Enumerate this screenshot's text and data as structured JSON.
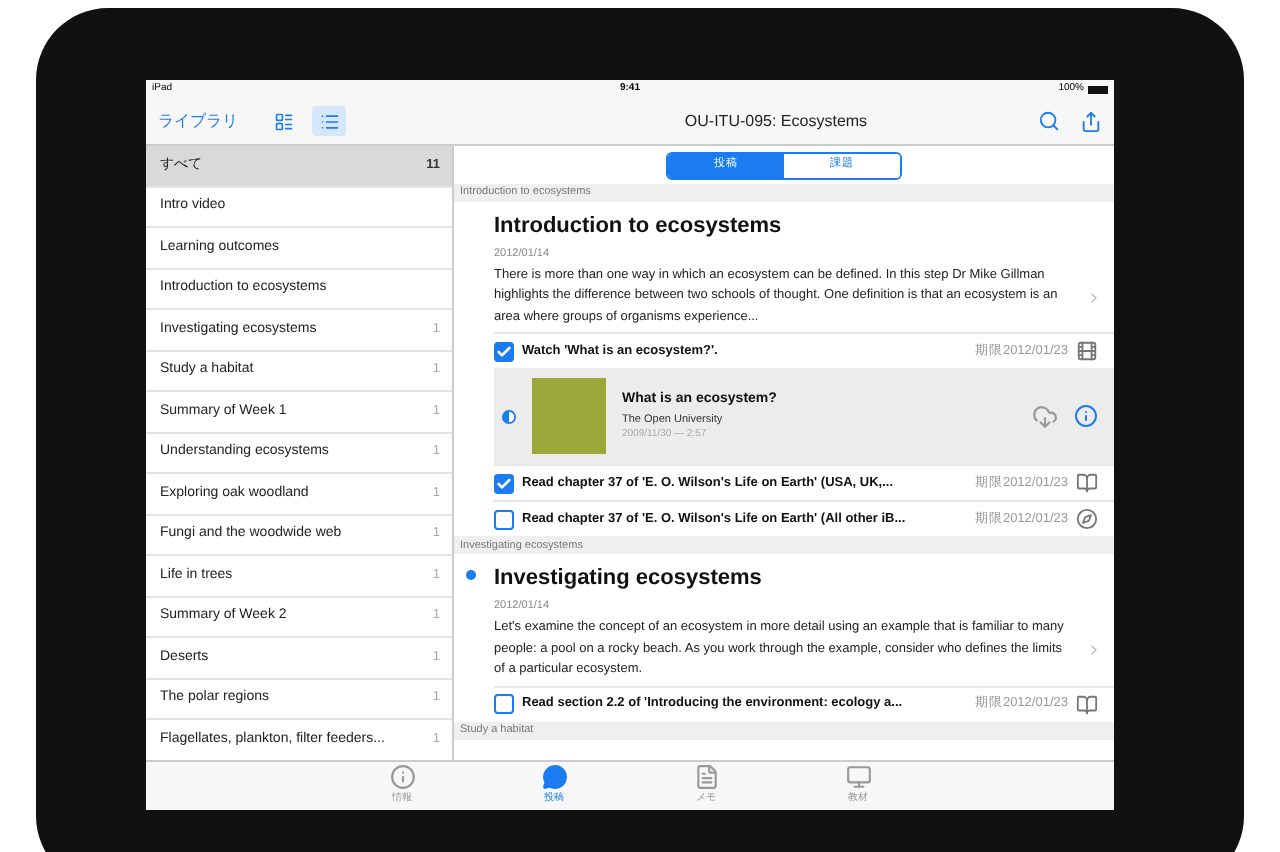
{
  "status_bar": {
    "device": "iPad",
    "time": "9:41",
    "battery": "100%"
  },
  "nav_bar": {
    "back": "ライブラリ",
    "title": "OU-ITU-095: Ecosystems",
    "view_buttons": [
      {
        "kind": "grid",
        "selected": false
      },
      {
        "kind": "list",
        "selected": true
      }
    ]
  },
  "sidebar": {
    "items": [
      {
        "label": "すべて",
        "count": "11",
        "selected": true
      },
      {
        "label": "Intro video",
        "selected": false
      },
      {
        "label": "Learning outcomes",
        "selected": false
      },
      {
        "label": "Introduction to ecosystems",
        "selected": false
      },
      {
        "label": "Investigating ecosystems",
        "count": "1",
        "selected": false
      },
      {
        "label": "Study a habitat",
        "count": "1",
        "selected": false
      },
      {
        "label": "Summary of Week 1",
        "count": "1",
        "selected": false
      },
      {
        "label": "Understanding ecosystems",
        "count": "1",
        "selected": false
      },
      {
        "label": "Exploring oak woodland",
        "count": "1",
        "selected": false
      },
      {
        "label": "Fungi and the woodwide web",
        "count": "1",
        "selected": false
      },
      {
        "label": "Life in trees",
        "count": "1",
        "selected": false
      },
      {
        "label": "Summary of Week 2",
        "count": "1",
        "selected": false
      },
      {
        "label": "Deserts",
        "count": "1",
        "selected": false
      },
      {
        "label": "The polar regions",
        "count": "1",
        "selected": false
      },
      {
        "label": "Flagellates, plankton, filter feeders...",
        "count": "1",
        "selected": false
      }
    ]
  },
  "segments": [
    {
      "label": "投稿",
      "selected": true
    },
    {
      "label": "課題",
      "selected": false
    }
  ],
  "sections": [
    {
      "header": "Introduction to ecosystems",
      "posts": [
        {
          "title": "Introduction to ecosystems",
          "unread": false,
          "date": "2012/01/14",
          "body": "There is more than one way in which an ecosystem can be defined. In this step Dr Mike Gillman highlights the difference between two schools of thought. One definition is that an ecosystem is an area where groups of organisms experience...",
          "tasks": [
            {
              "kind": "video",
              "checked": true,
              "text": "Watch 'What is an ecosystem?'.",
              "due": "期限2012/01/23",
              "media": {
                "title": "What is an ecosystem?",
                "source": "The Open University",
                "meta": "2009/11/30 — 2:57"
              }
            },
            {
              "kind": "reading",
              "checked": true,
              "text": "Read chapter 37 of 'E. O. Wilson's Life on Earth' (USA, UK,...",
              "due": "期限2012/01/23"
            },
            {
              "kind": "activity",
              "checked": false,
              "text": "Read chapter 37 of 'E. O. Wilson's Life on Earth' (All other iB...",
              "due": "期限2012/01/23"
            }
          ]
        }
      ]
    },
    {
      "header": "Investigating ecosystems",
      "posts": [
        {
          "title": "Investigating ecosystems",
          "unread": true,
          "date": "2012/01/14",
          "body": "Let's examine the concept of an ecosystem in more detail using an example that is familiar to many people: a pool on a rocky beach. As you work through the example, consider who defines the limits of a particular ecosystem.",
          "tasks": [
            {
              "kind": "reading",
              "checked": false,
              "text": "Read section 2.2 of 'Introducing the environment: ecology a...",
              "due": "期限2012/01/23"
            }
          ]
        }
      ]
    },
    {
      "header": "Study a habitat"
    }
  ],
  "tab_bar": [
    {
      "kind": "info",
      "label": "情報",
      "selected": false
    },
    {
      "kind": "posts",
      "label": "投稿",
      "selected": true
    },
    {
      "kind": "memo",
      "label": "メモ",
      "selected": false
    },
    {
      "kind": "material",
      "label": "教材",
      "selected": false
    }
  ]
}
